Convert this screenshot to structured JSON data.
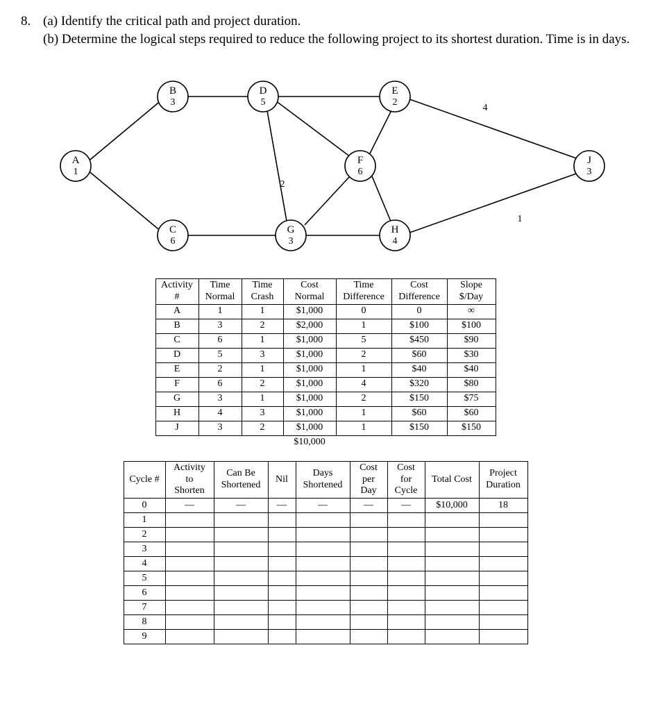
{
  "question": {
    "number": "8.",
    "partA": "(a) Identify the critical path and project duration.",
    "partB": "(b) Determine the logical steps required to reduce the following project to its shortest duration. Time is in days."
  },
  "diagram": {
    "nodes": {
      "A": {
        "label": "A",
        "value": "1"
      },
      "B": {
        "label": "B",
        "value": "3"
      },
      "C": {
        "label": "C",
        "value": "6"
      },
      "D": {
        "label": "D",
        "value": "5"
      },
      "E": {
        "label": "E",
        "value": "2"
      },
      "F": {
        "label": "F",
        "value": "6"
      },
      "G": {
        "label": "G",
        "value": "3"
      },
      "H": {
        "label": "H",
        "value": "4"
      },
      "J": {
        "label": "J",
        "value": "3"
      }
    },
    "edgeLabels": {
      "DG": "2",
      "EJ": "4",
      "HJ": "1"
    }
  },
  "table1": {
    "headers": {
      "activity": "Activity\n#",
      "tnorm": "Time\nNormal",
      "tcrash": "Time\nCrash",
      "cnorm": "Cost\nNormal",
      "tdiff": "Time\nDifference",
      "cdiff": "Cost\nDifference",
      "slope": "Slope\n$/Day"
    },
    "rows": [
      {
        "a": "A",
        "tn": "1",
        "tc": "1",
        "cn": "$1,000",
        "td": "0",
        "cd": "0",
        "sl": "∞"
      },
      {
        "a": "B",
        "tn": "3",
        "tc": "2",
        "cn": "$2,000",
        "td": "1",
        "cd": "$100",
        "sl": "$100"
      },
      {
        "a": "C",
        "tn": "6",
        "tc": "1",
        "cn": "$1,000",
        "td": "5",
        "cd": "$450",
        "sl": "$90"
      },
      {
        "a": "D",
        "tn": "5",
        "tc": "3",
        "cn": "$1,000",
        "td": "2",
        "cd": "$60",
        "sl": "$30"
      },
      {
        "a": "E",
        "tn": "2",
        "tc": "1",
        "cn": "$1,000",
        "td": "1",
        "cd": "$40",
        "sl": "$40"
      },
      {
        "a": "F",
        "tn": "6",
        "tc": "2",
        "cn": "$1,000",
        "td": "4",
        "cd": "$320",
        "sl": "$80"
      },
      {
        "a": "G",
        "tn": "3",
        "tc": "1",
        "cn": "$1,000",
        "td": "2",
        "cd": "$150",
        "sl": "$75"
      },
      {
        "a": "H",
        "tn": "4",
        "tc": "3",
        "cn": "$1,000",
        "td": "1",
        "cd": "$60",
        "sl": "$60"
      },
      {
        "a": "J",
        "tn": "3",
        "tc": "2",
        "cn": "$1,000",
        "td": "1",
        "cd": "$150",
        "sl": "$150"
      }
    ],
    "total": "$10,000"
  },
  "table2": {
    "headers": {
      "cycle": "Cycle #",
      "act": "Activity\nto\nShorten",
      "canbe": "Can Be\nShortened",
      "nil": "Nil",
      "days": "Days\nShortened",
      "costday": "Cost\nper\nDay",
      "costcyc": "Cost\nfor\nCycle",
      "totcost": "Total Cost",
      "dur": "Project\nDuration"
    },
    "rows": [
      {
        "n": "0",
        "act": "—",
        "canbe": "—",
        "nil": "—",
        "days": "—",
        "cpd": "—",
        "cfc": "—",
        "tc": "$10,000",
        "dur": "18"
      },
      {
        "n": "1",
        "act": "",
        "canbe": "",
        "nil": "",
        "days": "",
        "cpd": "",
        "cfc": "",
        "tc": "",
        "dur": ""
      },
      {
        "n": "2",
        "act": "",
        "canbe": "",
        "nil": "",
        "days": "",
        "cpd": "",
        "cfc": "",
        "tc": "",
        "dur": ""
      },
      {
        "n": "3",
        "act": "",
        "canbe": "",
        "nil": "",
        "days": "",
        "cpd": "",
        "cfc": "",
        "tc": "",
        "dur": ""
      },
      {
        "n": "4",
        "act": "",
        "canbe": "",
        "nil": "",
        "days": "",
        "cpd": "",
        "cfc": "",
        "tc": "",
        "dur": ""
      },
      {
        "n": "5",
        "act": "",
        "canbe": "",
        "nil": "",
        "days": "",
        "cpd": "",
        "cfc": "",
        "tc": "",
        "dur": ""
      },
      {
        "n": "6",
        "act": "",
        "canbe": "",
        "nil": "",
        "days": "",
        "cpd": "",
        "cfc": "",
        "tc": "",
        "dur": ""
      },
      {
        "n": "7",
        "act": "",
        "canbe": "",
        "nil": "",
        "days": "",
        "cpd": "",
        "cfc": "",
        "tc": "",
        "dur": ""
      },
      {
        "n": "8",
        "act": "",
        "canbe": "",
        "nil": "",
        "days": "",
        "cpd": "",
        "cfc": "",
        "tc": "",
        "dur": ""
      },
      {
        "n": "9",
        "act": "",
        "canbe": "",
        "nil": "",
        "days": "",
        "cpd": "",
        "cfc": "",
        "tc": "",
        "dur": ""
      }
    ]
  }
}
